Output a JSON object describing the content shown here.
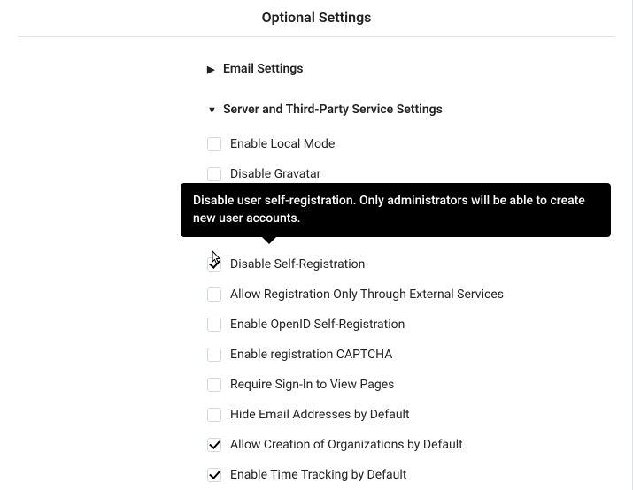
{
  "title": "Optional Settings",
  "sections": {
    "email": {
      "label": "Email Settings",
      "expanded": false
    },
    "server": {
      "label": "Server and Third-Party Service Settings",
      "expanded": true
    }
  },
  "options": [
    {
      "key": "local-mode",
      "label": "Enable Local Mode",
      "checked": false
    },
    {
      "key": "disable-gravatar",
      "label": "Disable Gravatar",
      "checked": false
    },
    {
      "key": "hidden-row-1",
      "label": "",
      "checked": false
    },
    {
      "key": "hidden-row-2",
      "label": "",
      "checked": false
    },
    {
      "key": "disable-self-registration",
      "label": "Disable Self-Registration",
      "checked": true
    },
    {
      "key": "external-only",
      "label": "Allow Registration Only Through External Services",
      "checked": false
    },
    {
      "key": "openid-self-reg",
      "label": "Enable OpenID Self-Registration",
      "checked": false
    },
    {
      "key": "captcha",
      "label": "Enable registration CAPTCHA",
      "checked": false
    },
    {
      "key": "signin-view",
      "label": "Require Sign-In to View Pages",
      "checked": false
    },
    {
      "key": "hide-email",
      "label": "Hide Email Addresses by Default",
      "checked": false
    },
    {
      "key": "org-creation",
      "label": "Allow Creation of Organizations by Default",
      "checked": true
    },
    {
      "key": "time-tracking",
      "label": "Enable Time Tracking by Default",
      "checked": true
    }
  ],
  "tooltip": "Disable user self-registration. Only administrators will be able to create new user accounts."
}
